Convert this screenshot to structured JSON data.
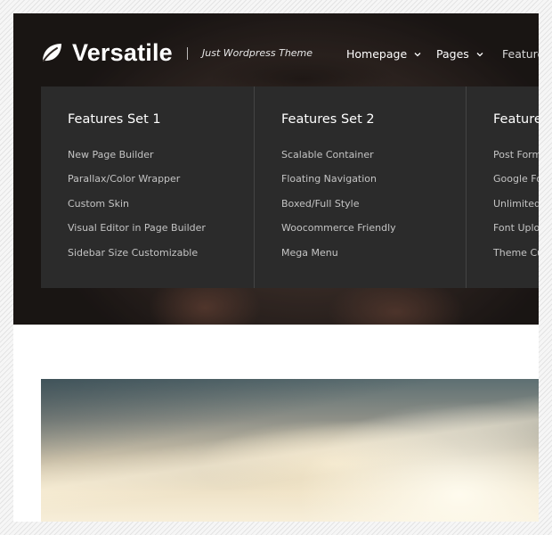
{
  "brand": {
    "name": "Versatile",
    "tagline": "Just Wordpress Theme",
    "icon": "leaf-icon"
  },
  "nav": {
    "items": [
      {
        "label": "Homepage",
        "has_dropdown": true
      },
      {
        "label": "Pages",
        "has_dropdown": true
      },
      {
        "label": "Feature",
        "has_dropdown": false
      }
    ]
  },
  "mega_menu": {
    "columns": [
      {
        "title": "Features Set 1",
        "links": [
          "New Page Builder",
          "Parallax/Color Wrapper",
          "Custom Skin",
          "Visual Editor in Page Builder",
          "Sidebar Size Customizable"
        ]
      },
      {
        "title": "Features Set 2",
        "links": [
          "Scalable Container",
          "Floating Navigation",
          "Boxed/Full Style",
          "Woocommerce Friendly",
          "Mega Menu"
        ]
      },
      {
        "title": "Feature",
        "links": [
          "Post Forma",
          "Google Fo",
          "Unlimited",
          "Font Uploa",
          "Theme Cus"
        ]
      }
    ]
  },
  "colors": {
    "menu_bg": "#2b2b2b",
    "menu_link": "#c4c4c4",
    "menu_title": "#ffffff",
    "page_bg": "#ffffff"
  }
}
